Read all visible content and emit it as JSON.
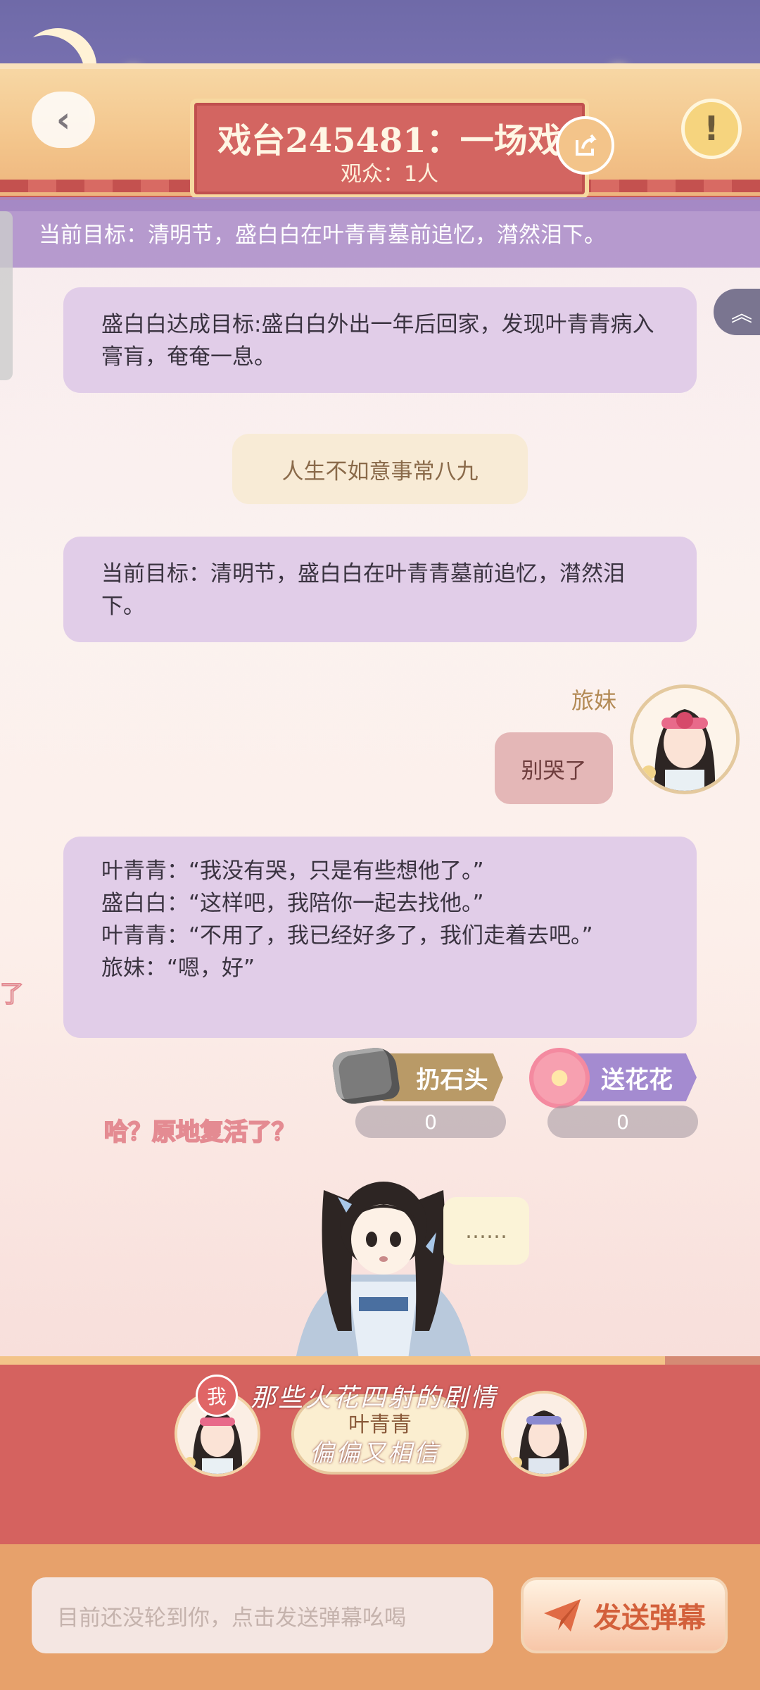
{
  "header": {
    "title": "戏台245481：一场戏",
    "audience": "观众：1人"
  },
  "goal_banner": "当前目标：清明节，盛白白在叶青青墓前追忆，潸然泪下。",
  "messages": {
    "system1": "盛白白达成目标:盛白白外出一年后回家，发现叶青青病入膏肓，奄奄一息。",
    "narration": "人生不如意事常八九",
    "system2": "当前目标：清明节，盛白白在叶青青墓前追忆，潸然泪下。",
    "user_name": "旅妹",
    "user_message": "别哭了",
    "dialogue": [
      "叶青青：“我没有哭，只是有些想他了。”",
      "盛白白：“这样吧，我陪你一起去找他。”",
      "叶青青：“不用了，我已经好多了，我们走着去吧。”",
      "旅妹：“嗯，好”"
    ]
  },
  "reactions": {
    "stone_label": "扔石头",
    "stone_count": "0",
    "flower_label": "送花花",
    "flower_count": "0"
  },
  "floating": {
    "danmaku": "哈？原地复活了？",
    "edge_fragment": "了",
    "speech": "……"
  },
  "stage": {
    "me_badge": "我",
    "current_name": "叶青青",
    "caption1": "那些火花四射的剧情",
    "caption2": "偏偏又相信"
  },
  "input": {
    "placeholder": "目前还没轮到你，点击发送弹幕吆喝",
    "send_label": "发送弹幕"
  },
  "colors": {
    "sky": "#6f6aa8",
    "plaque": "#d36561",
    "bubble_system": "#e1cde8",
    "bubble_user": "#e4b7b7",
    "stage_panel": "#d5625f",
    "input_bar": "#e7a16b"
  }
}
